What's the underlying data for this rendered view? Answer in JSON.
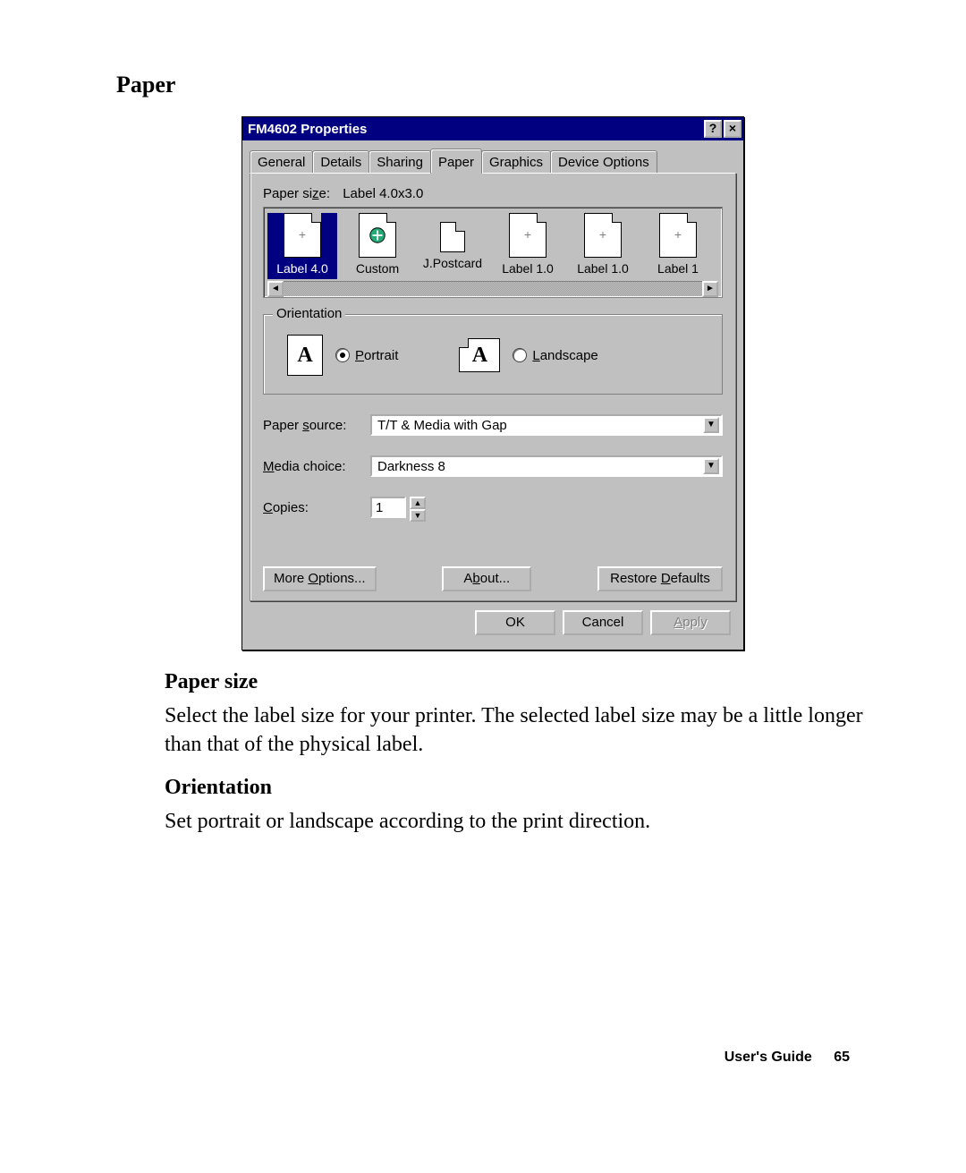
{
  "doc": {
    "section_heading": "Paper",
    "paper_size_heading": "Paper size",
    "paper_size_text": "Select the label size for your printer.  The selected label size may be a little longer than that of the physical label.",
    "orientation_heading": "Orientation",
    "orientation_text": "Set portrait or landscape according to the print direction.",
    "footer_label": "User's Guide",
    "page_number": "65"
  },
  "dialog": {
    "title": "FM4602 Properties",
    "tabs": [
      "General",
      "Details",
      "Sharing",
      "Paper",
      "Graphics",
      "Device Options"
    ],
    "active_tab": "Paper",
    "paper_size": {
      "label": "Paper size:",
      "value": "Label 4.0x3.0",
      "items": [
        "Label 4.0",
        "Custom",
        "J.Postcard",
        "Label 1.0",
        "Label 1.0",
        "Label 1"
      ],
      "selected_index": 0
    },
    "orientation": {
      "legend": "Orientation",
      "portrait_label": "Portrait",
      "landscape_label": "Landscape",
      "selected": "portrait"
    },
    "paper_source": {
      "label": "Paper source:",
      "value": "T/T & Media with Gap"
    },
    "media_choice": {
      "label": "Media choice:",
      "value": "Darkness 8"
    },
    "copies": {
      "label": "Copies:",
      "value": "1"
    },
    "buttons": {
      "more_options": "More Options...",
      "about": "About...",
      "restore_defaults": "Restore Defaults",
      "ok": "OK",
      "cancel": "Cancel",
      "apply": "Apply"
    }
  }
}
